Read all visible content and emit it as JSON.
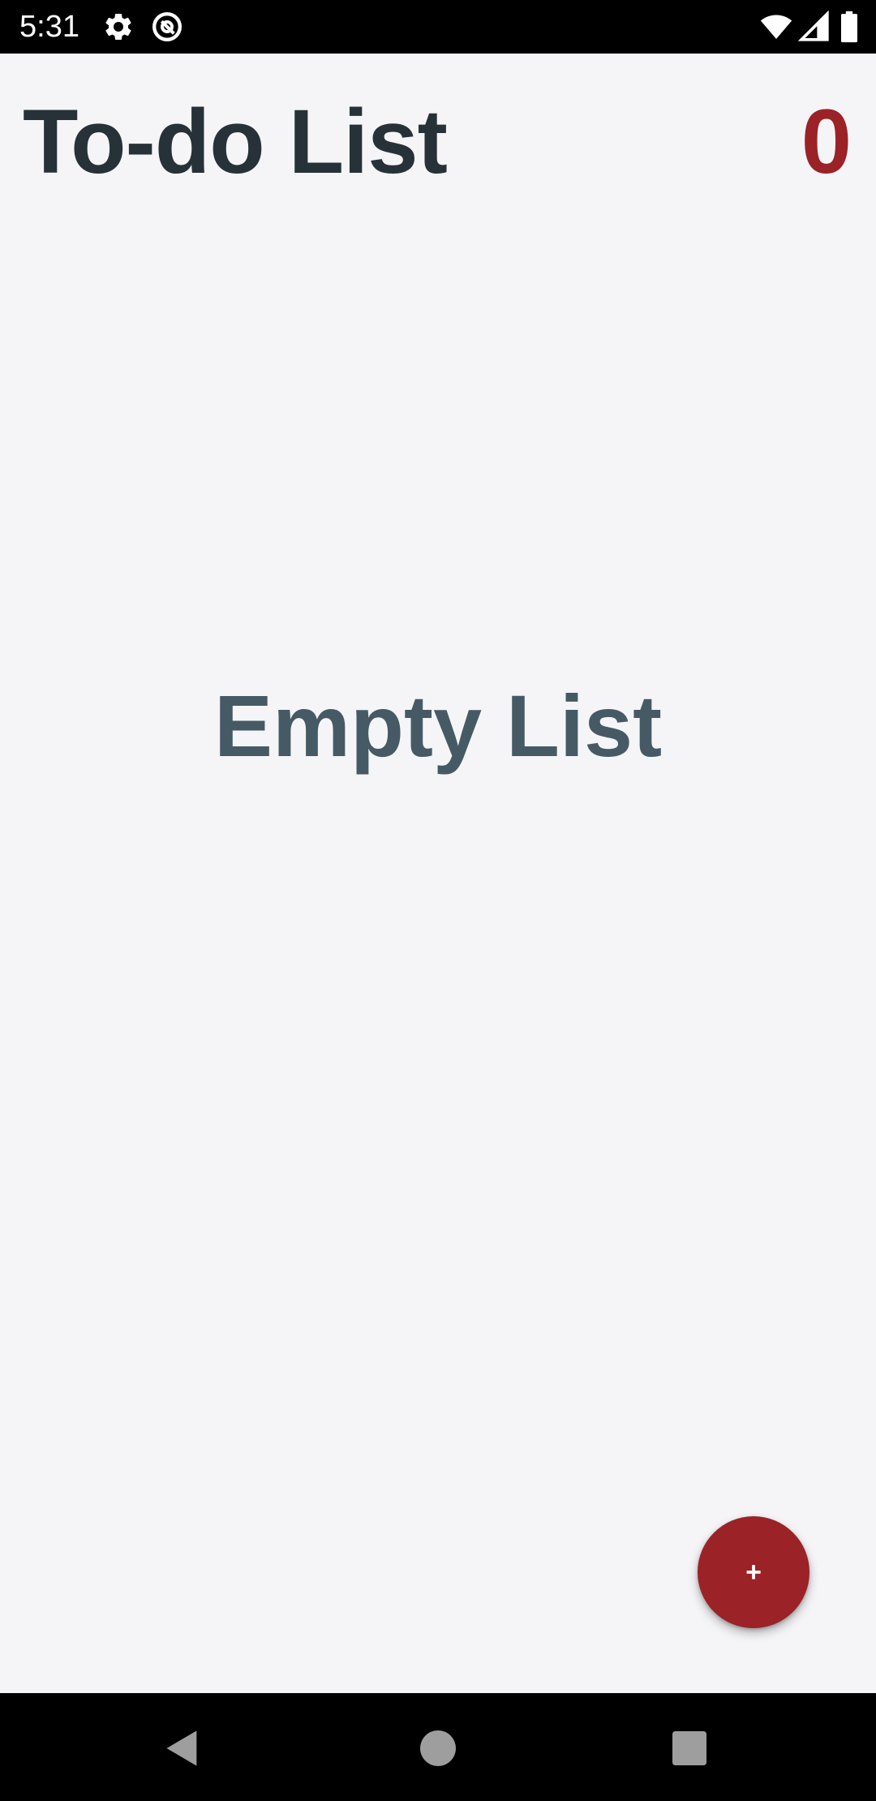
{
  "status_bar": {
    "time": "5:31",
    "left_icons": [
      "gear-icon",
      "at-sign-icon"
    ],
    "right_icons": [
      "wifi-icon",
      "signal-icon",
      "battery-icon"
    ]
  },
  "app": {
    "title": "To-do List",
    "task_count": "0",
    "empty_message": "Empty List",
    "fab_label": "+",
    "colors": {
      "accent": "#9b2226",
      "title": "#263238",
      "empty_text": "#455a64",
      "background": "#f5f5f8"
    }
  },
  "nav_bar": {
    "buttons": [
      "back-icon",
      "home-icon",
      "recents-icon"
    ]
  }
}
